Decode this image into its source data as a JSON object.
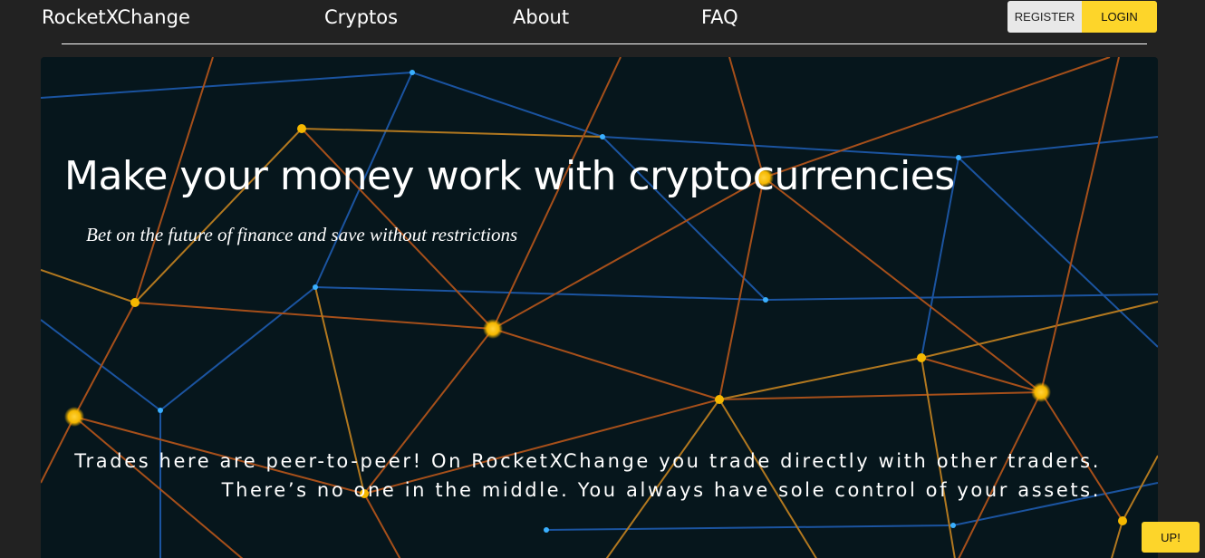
{
  "navbar": {
    "brand": "RocketXChange",
    "links": [
      "Cryptos",
      "About",
      "FAQ"
    ],
    "register_label": "REGISTER",
    "login_label": "LOGIN"
  },
  "hero": {
    "title": "Make your money work with cryptocurrencies",
    "subtitle": "Bet on the future of finance and save without restrictions",
    "body": "Trades here are peer-to-peer! On RocketXChange you trade directly with other traders. There’s no one in the middle. You always have sole control of your assets."
  },
  "up_button_label": "UP!",
  "colors": {
    "page_background": "#222222",
    "hero_background": "#06161c",
    "accent_yellow": "#fdd52a",
    "register_bg": "#e8e8e8",
    "node_gold": "#f5b800",
    "node_blue": "#3ab0ff",
    "line_orange": "#d2691e",
    "line_blue": "#1f5fb8"
  }
}
